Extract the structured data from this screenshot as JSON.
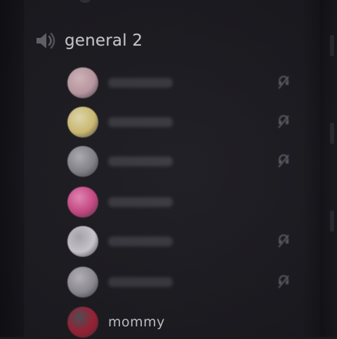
{
  "channel": {
    "name": "general 2",
    "icon": "speaker-icon"
  },
  "members": [
    {
      "name": "",
      "avatar_color": "#c9a3ad",
      "avatar_accent": "#e2c6cc",
      "has_status_icon": true
    },
    {
      "name": "",
      "avatar_color": "#d9c679",
      "avatar_accent": "#f1e7b8",
      "has_status_icon": true
    },
    {
      "name": "",
      "avatar_color": "#8a8890",
      "avatar_accent": "#b9b7bd",
      "has_status_icon": true
    },
    {
      "name": "",
      "avatar_color": "#d14a8a",
      "avatar_accent": "#f28fc2",
      "has_status_icon": false
    },
    {
      "name": "",
      "avatar_color": "#d8d6dc",
      "avatar_accent": "#b3b1b8",
      "has_status_icon": true
    },
    {
      "name": "",
      "avatar_color": "#9a98a0",
      "avatar_accent": "#c7c5cb",
      "has_status_icon": true
    },
    {
      "name": "mommy",
      "avatar_color": "#b0233a",
      "avatar_accent": "#5a5860",
      "has_status_icon": false
    }
  ]
}
